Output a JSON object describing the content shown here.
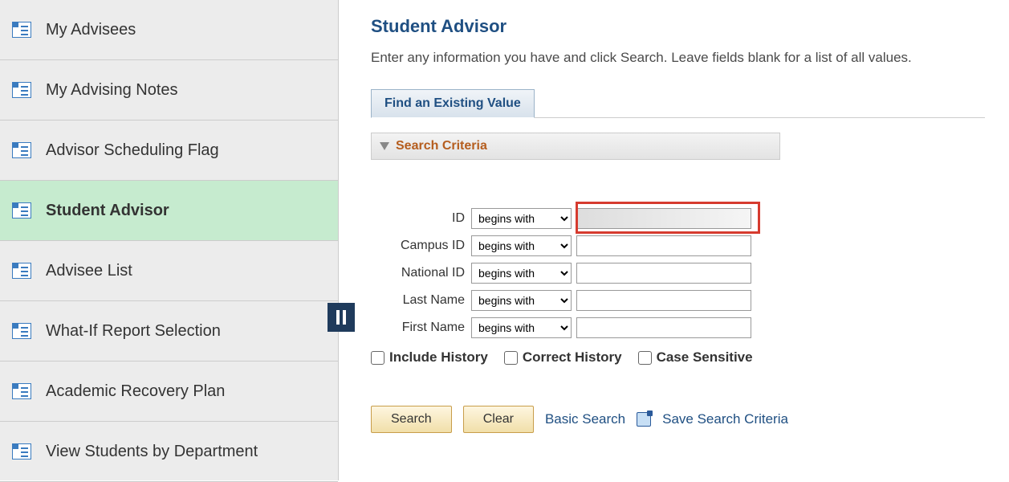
{
  "sidebar": {
    "items": [
      {
        "label": "My Advisees"
      },
      {
        "label": "My Advising Notes"
      },
      {
        "label": "Advisor Scheduling Flag"
      },
      {
        "label": "Student Advisor"
      },
      {
        "label": "Advisee List"
      },
      {
        "label": "What-If Report Selection"
      },
      {
        "label": "Academic Recovery Plan"
      },
      {
        "label": "View Students by Department"
      }
    ],
    "active_index": 3
  },
  "page": {
    "title": "Student Advisor",
    "instructions": "Enter any information you have and click Search. Leave fields blank for a list of all values."
  },
  "tabs": {
    "find_existing": "Find an Existing Value"
  },
  "criteria": {
    "title": "Search Criteria",
    "fields": {
      "id": {
        "label": "ID",
        "op": "begins with",
        "value": ""
      },
      "campus_id": {
        "label": "Campus ID",
        "op": "begins with",
        "value": ""
      },
      "national_id": {
        "label": "National ID",
        "op": "begins with",
        "value": ""
      },
      "last_name": {
        "label": "Last Name",
        "op": "begins with",
        "value": ""
      },
      "first_name": {
        "label": "First Name",
        "op": "begins with",
        "value": ""
      }
    },
    "checks": {
      "include_history": "Include History",
      "correct_history": "Correct History",
      "case_sensitive": "Case Sensitive"
    }
  },
  "actions": {
    "search": "Search",
    "clear": "Clear",
    "basic_search": "Basic Search",
    "save_criteria": "Save Search Criteria"
  }
}
